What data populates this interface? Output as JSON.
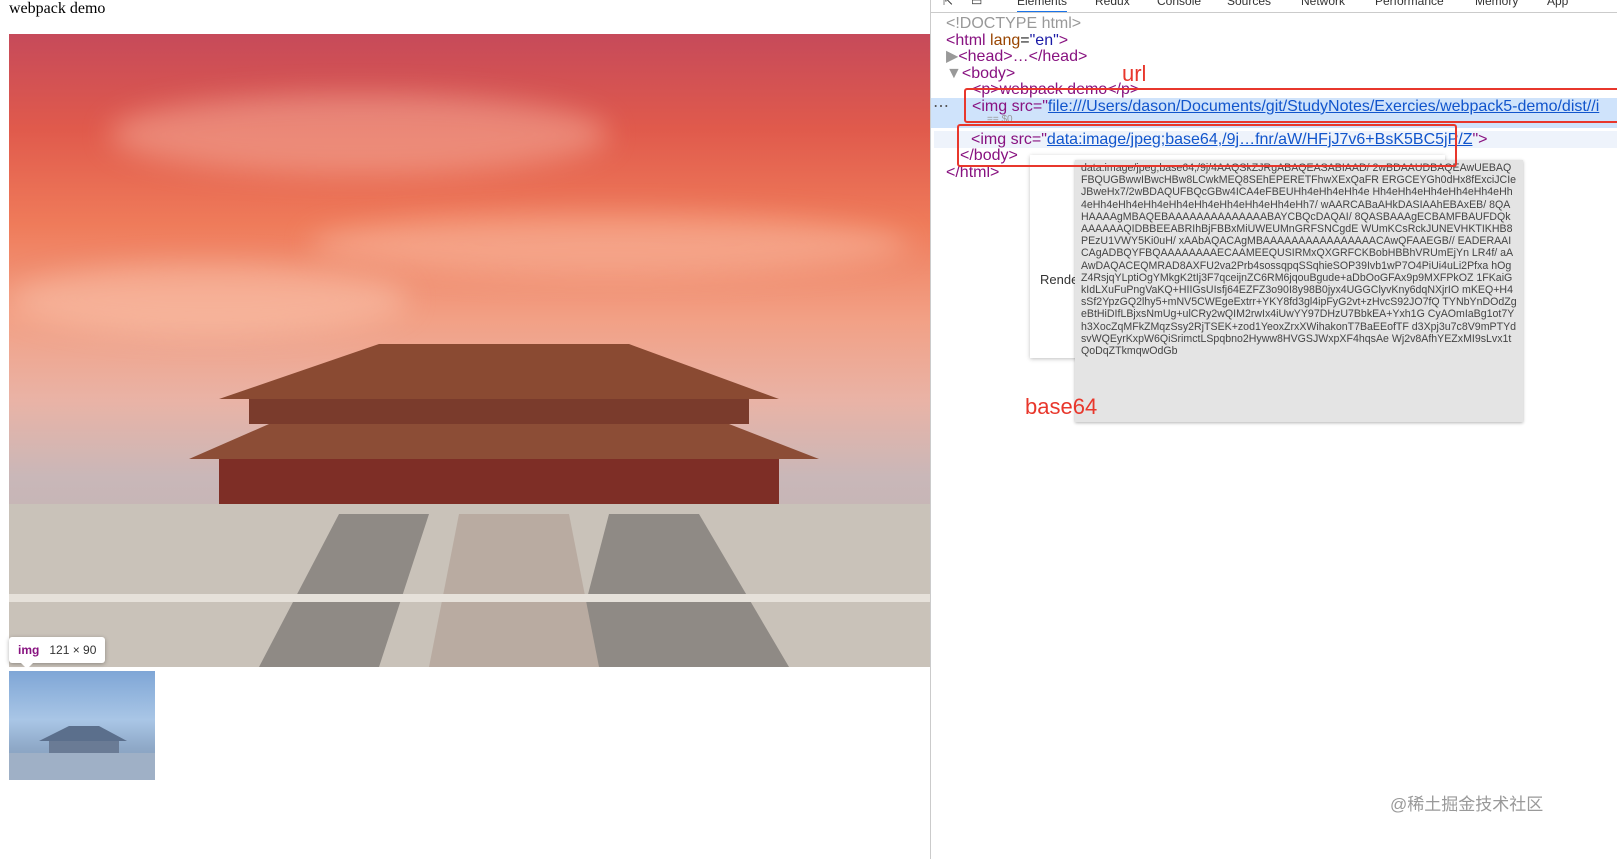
{
  "page": {
    "title": "webpack demo"
  },
  "inspect_tooltip": {
    "tag": "img",
    "size": "121 × 90"
  },
  "devtools": {
    "tabs": [
      "Elements",
      "Redux",
      "Console",
      "Sources",
      "Network",
      "Performance",
      "Memory",
      "App"
    ],
    "active_tab": "Elements",
    "dom": {
      "doctype": "<!DOCTYPE html>",
      "html_open": "<html",
      "lang_attr": "lang",
      "lang_val": "\"en\"",
      "head": "<head>…</head>",
      "body_open": "<body>",
      "p": "<p>webpack demo</p>",
      "img1_prefix": "<img src=\"",
      "img1_src": "file:///Users/dason/Documents/git/StudyNotes/Exercies/webpack5-demo/dist//i",
      "img1_eq": "== $0",
      "img2_prefix": "<img src=\"",
      "img2_src": "data:image/jpeg;base64,/9j…fnr/aW/HFjJ7v6+BsK5BC5jP/Z",
      "img2_suffix": "\">",
      "body_close": "</body>",
      "html_close": "</html>"
    },
    "rendered_label": "Rende",
    "base64_tooltip": "data:image/jpeg;base64,/9j/4AAQSkZJRgABAQEASABIAAD/ 2wBDAAUDBAQEAwUEBAQFBQUGBwwIBwcHBw8LCwkMEQ8SEhEPERETFhwXExQaFR ERGCEYGh0dHx8fExciJCIeJBweHx7/2wBDAQUFBQcGBw4ICA4eFBEUHh4eHh4eHh4e Hh4eHh4eHh4eHh4eHh4eHh4eHh4eHh4eHh4eHh4eHh4eHh4eHh4eHh4eHh7/ wAARCABaAHkDASIAAhEBAxEB/ 8QAHAAAAgMBAQEBAAAAAAAAAAAAAABAYCBQcDAQAI/ 8QASBAAAgECBAMFBAUFDQkAAAAAAQIDBBEEABRIhBjFBBxMiUWEUMnGRFSNCgdE WUmKCsRckJUNEVHKTIKHB8PEzU1VWY5Ki0uH/ xAAbAQACAgMBAAAAAAAAAAAAAAAACAwQFAAEGB// EADERAAICAgADBQYFBQAAAAAAAAECAAMEEQUSIRMxQXGRFCKBobHBBhVRUmEjYn LR4f/ aAAwDAQACEQMRAD8AXFU2va2Prb4sossqpqSSqhieSOP39Ivb1wP7O4PiUi4uLi2Pfxa hOgZ4RsjqYLptiOgYMkgK2tIj3F7qceijnZC6RM6jqouBgude+aDbOoGFAx9p9MXFPkOZ 1FKaiGkIdLXuFuPngVaKQ+HIIGsUIsfj64EZFZ3o90I8y98B0jyx4UGGClyvKny6dqNXjrIO mKEQ+H4sSf2YpzGQ2lhy5+mNV5CWEgeExtrr+YKY8fd3gl4ipFyG2vt+zHvcS92JO7fQ TYNbYnDOdZgeBtHiDIfLBjxsNmUg+ulCRy2wQIM2rwIx4iUwYY97DHzU7BbkEA+Yxh1G CyAOmIaBg1ot7Yh3XocZqMFkZMqzSsy2RjTSEK+zod1YeoxZrxXWihakonT7BaEEofTF d3Xpj3u7c8V9mPTYdsvWQEyrKxpW6QiSrimctLSpqbno2Hyww8HVGSJWxpXF4hqsAe Wj2v8AfhYEZxMI9sLvx1tQoDqZTkmqwOdGb"
  },
  "annotations": {
    "url": "url",
    "base64": "base64"
  },
  "watermark": "@稀土掘金技术社区",
  "colors": {
    "annotation": "#e8372c",
    "link": "#1155cc",
    "tag": "#881280"
  }
}
